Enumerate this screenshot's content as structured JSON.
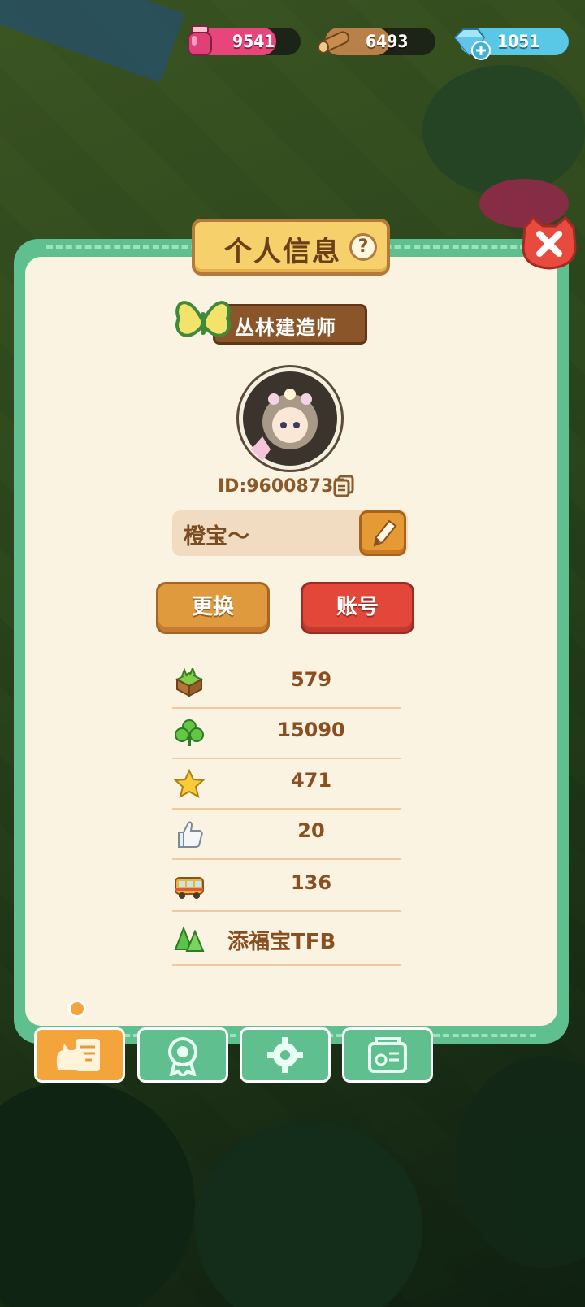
{
  "resources": [
    {
      "name": "potion",
      "value": "9541"
    },
    {
      "name": "wood",
      "value": "6493"
    },
    {
      "name": "diamond",
      "value": "1051"
    }
  ],
  "panel": {
    "title": "个人信息",
    "help_glyph": "?",
    "rank_title": "丛林建造师",
    "player_id": "ID:96008737",
    "nickname": "橙宝～",
    "change_button": "更换",
    "account_button": "账号"
  },
  "stats": [
    {
      "icon": "grass-block-icon",
      "value": "579"
    },
    {
      "icon": "clover-icon",
      "value": "15090"
    },
    {
      "icon": "star-icon",
      "value": "471"
    },
    {
      "icon": "thumbs-up-icon",
      "value": "20"
    },
    {
      "icon": "bus-icon",
      "value": "136"
    },
    {
      "icon": "tree-icon",
      "value": "添福宝TFB"
    }
  ],
  "tabs": [
    {
      "name": "profile",
      "icon": "cat-card-icon",
      "active": true
    },
    {
      "name": "badges",
      "icon": "medal-icon",
      "active": false
    },
    {
      "name": "settings",
      "icon": "gear-icon",
      "active": false
    },
    {
      "name": "album",
      "icon": "photo-album-icon",
      "active": false
    }
  ],
  "colors": {
    "panel_green": "#5fbf8e",
    "panel_cream": "#fbf3e2",
    "text_brown": "#8a4f20",
    "orange": "#e09a3e",
    "red": "#e2473a"
  }
}
